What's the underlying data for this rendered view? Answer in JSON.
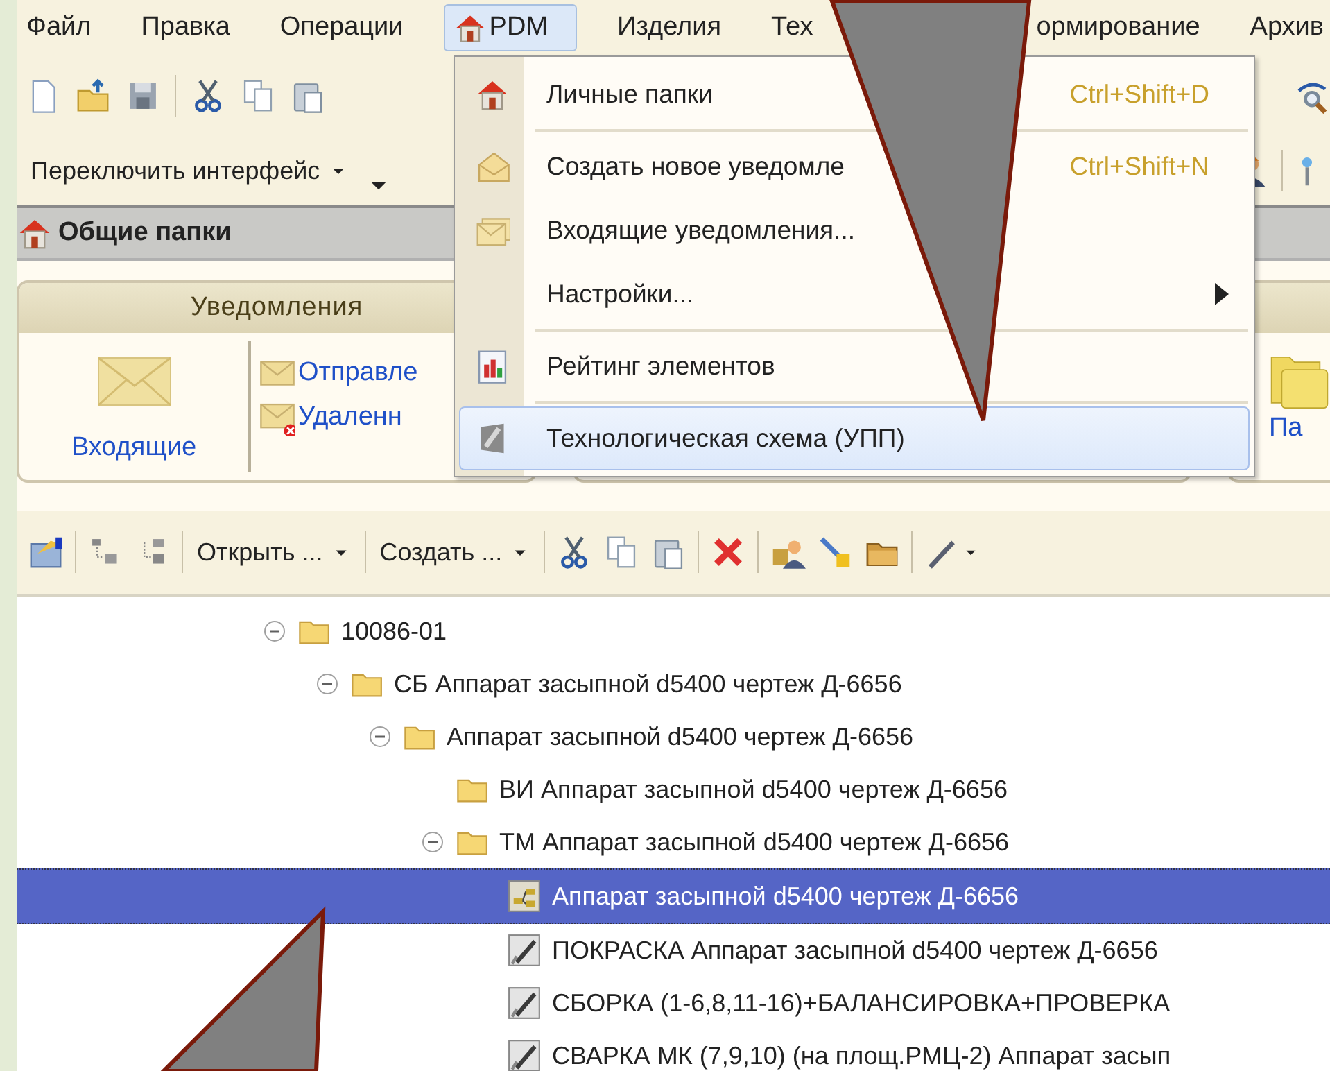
{
  "menu_bar": [
    {
      "label": "Файл",
      "selected": false
    },
    {
      "label": "Правка",
      "selected": false
    },
    {
      "label": "Операции",
      "selected": false
    },
    {
      "label": "PDM",
      "selected": true
    },
    {
      "label": "Изделия",
      "selected": false
    },
    {
      "label": "Тех",
      "selected": false
    },
    {
      "label": "ормирование",
      "selected": false
    },
    {
      "label": "Архив",
      "selected": false
    }
  ],
  "interface_switch": {
    "label": "Переключить интерфейс"
  },
  "window_title": "Общие папки",
  "notifications_panel": {
    "title": "Уведомления",
    "main_link": "Входящие",
    "links": [
      {
        "label": "Отправле",
        "kind": "sent"
      },
      {
        "label": "Удаленн",
        "kind": "deleted"
      }
    ]
  },
  "folders_panel": {
    "link": "Па"
  },
  "pdm_menu": [
    {
      "kind": "item",
      "label": "Личные папки",
      "shortcut": "Ctrl+Shift+D",
      "submenu": false,
      "selected": false
    },
    {
      "kind": "separator"
    },
    {
      "kind": "item",
      "label": "Создать новое уведомле",
      "shortcut": "Ctrl+Shift+N",
      "submenu": false,
      "selected": false
    },
    {
      "kind": "item",
      "label": "Входящие уведомления...",
      "submenu": false,
      "selected": false
    },
    {
      "kind": "item",
      "label": "Настройки...",
      "submenu": true,
      "selected": false
    },
    {
      "kind": "separator"
    },
    {
      "kind": "item",
      "label": "Рейтинг элементов",
      "submenu": false,
      "selected": false
    },
    {
      "kind": "separator"
    },
    {
      "kind": "item",
      "label": "Технологическая схема (УПП)",
      "submenu": false,
      "selected": true
    }
  ],
  "tree_toolbar": {
    "open_button": "Открыть ...",
    "create_button": "Создать ..."
  },
  "tree": [
    {
      "label": "10086-01",
      "kind": "folder",
      "expanded": true,
      "selected": false,
      "children": [
        {
          "label": "СБ Аппарат засыпной d5400 чертеж Д-6656",
          "kind": "folder",
          "expanded": true,
          "selected": false,
          "children": [
            {
              "label": "Аппарат засыпной d5400 чертеж Д-6656",
              "kind": "folder",
              "expanded": true,
              "selected": false,
              "children": [
                {
                  "label": "ВИ Аппарат засыпной d5400 чертеж Д-6656",
                  "kind": "folder",
                  "selected": false
                },
                {
                  "label": "ТМ Аппарат засыпной d5400 чертеж Д-6656",
                  "kind": "folder",
                  "expanded": true,
                  "selected": false,
                  "children": [
                    {
                      "label": "Аппарат засыпной d5400 чертеж Д-6656",
                      "kind": "scheme",
                      "selected": true
                    },
                    {
                      "label": "ПОКРАСКА Аппарат засыпной d5400 чертеж Д-6656",
                      "kind": "operation",
                      "selected": false
                    },
                    {
                      "label": "СБОРКА (1-6,8,11-16)+БАЛАНСИРОВКА+ПРОВЕРКА",
                      "kind": "operation",
                      "selected": false
                    },
                    {
                      "label": "СВАРКА МК (7,9,10) (на площ.РМЦ-2) Аппарат засып",
                      "kind": "operation",
                      "selected": false
                    }
                  ]
                }
              ]
            }
          ]
        }
      ]
    }
  ]
}
